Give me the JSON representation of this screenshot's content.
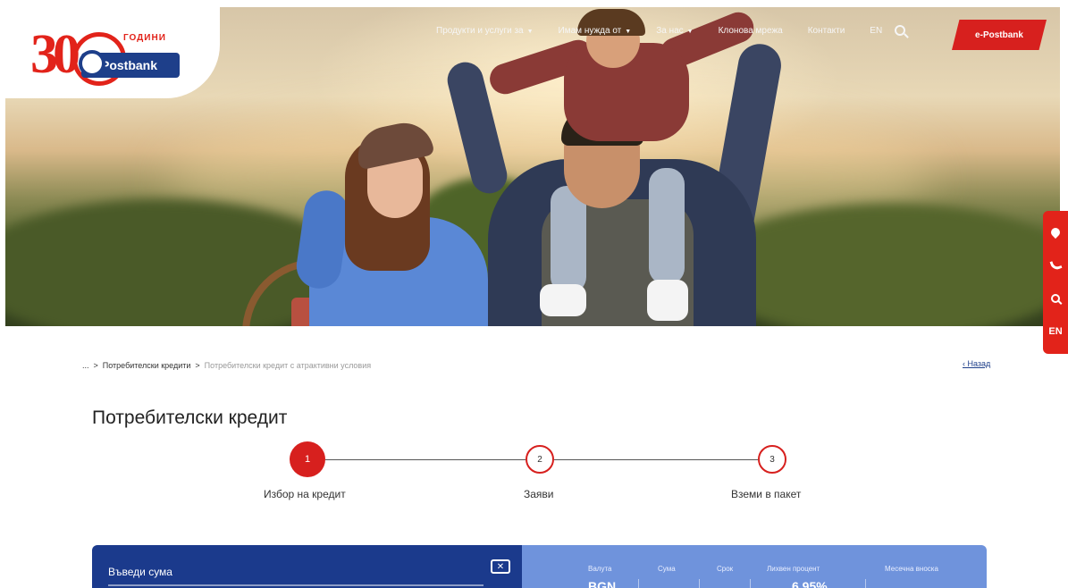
{
  "logo": {
    "anniversary": "30",
    "years": "ГОДИНИ",
    "brand": "Postbank"
  },
  "nav": {
    "items": [
      "Продукти и услуги за",
      "Имам нужда от",
      "За нас",
      "Клонова мрежа",
      "Контакти"
    ],
    "lang": "EN",
    "cta": "e-Postbank"
  },
  "side_tools": {
    "lang": "EN"
  },
  "breadcrumb": {
    "ellipsis": "...",
    "sep": ">",
    "level1": "Потребителски кредити",
    "current": "Потребителски кредит с атрактивни условия"
  },
  "back": "Назад",
  "page_title": "Потребителски кредит",
  "steps": [
    {
      "number": "1",
      "label": "Избор на кредит"
    },
    {
      "number": "2",
      "label": "Заяви"
    },
    {
      "number": "3",
      "label": "Вземи в пакет"
    }
  ],
  "calculator": {
    "input_label": "Въведи сума",
    "columns": [
      "Валута",
      "Сума",
      "Срок",
      "Лихвен процент",
      "Месечна вноска"
    ],
    "currency": "BGN",
    "rate": "6.95%"
  },
  "colors": {
    "brand_red": "#d7201e",
    "brand_blue": "#1b3a8c",
    "light_blue": "#6f93dc"
  }
}
